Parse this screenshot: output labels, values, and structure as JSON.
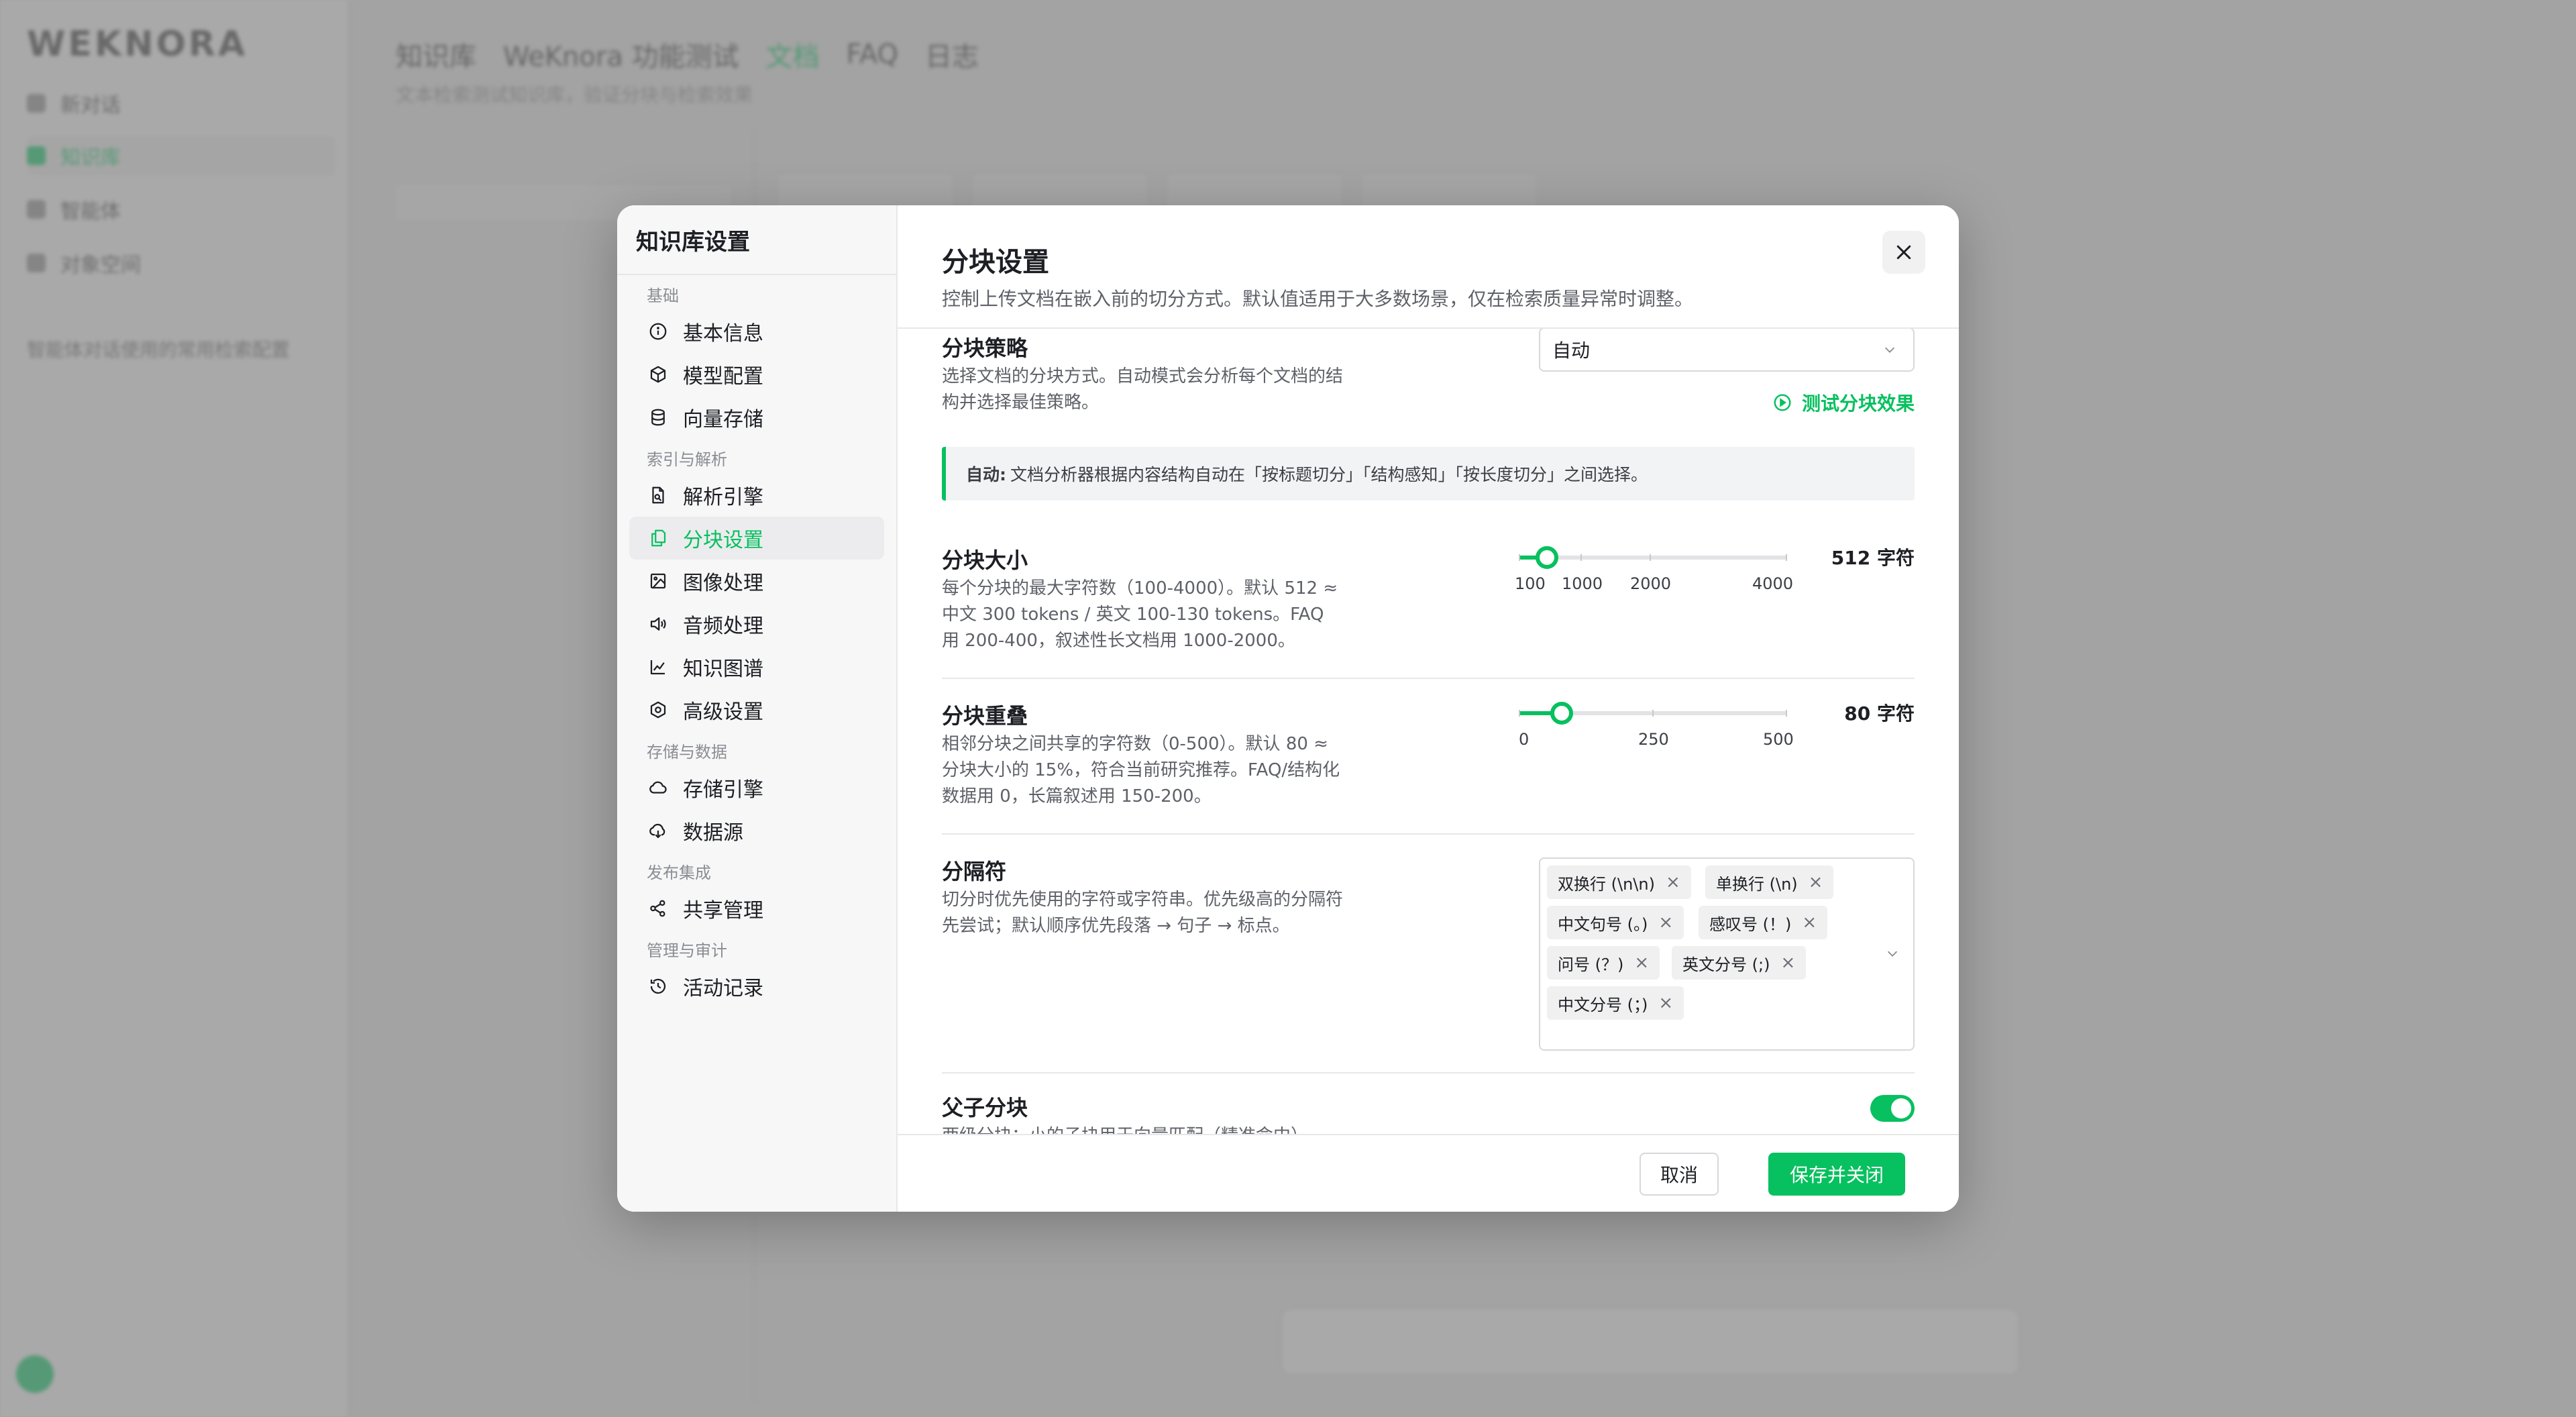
{
  "background": {
    "logo": "WEKNORA",
    "nav": [
      "新对话",
      "知识库",
      "智能体",
      "对象空间"
    ],
    "recent": "智能体对话使用的常用检索配置",
    "header": [
      "知识库",
      "WeKnora 功能测试",
      "文档",
      "FAQ",
      "日志"
    ],
    "subtitle": "文本检索测试知识库，验证分块与检索效果"
  },
  "modal": {
    "nav_title": "知识库设置",
    "groups": [
      {
        "label": "基础",
        "items": [
          {
            "label": "基本信息",
            "icon": "info-icon"
          },
          {
            "label": "模型配置",
            "icon": "cube-icon"
          },
          {
            "label": "向量存储",
            "icon": "database-icon"
          }
        ]
      },
      {
        "label": "索引与解析",
        "items": [
          {
            "label": "解析引擎",
            "icon": "file-search-icon"
          },
          {
            "label": "分块设置",
            "icon": "copy-icon",
            "active": true
          },
          {
            "label": "图像处理",
            "icon": "image-icon"
          },
          {
            "label": "音频处理",
            "icon": "speaker-icon"
          },
          {
            "label": "知识图谱",
            "icon": "graph-icon"
          },
          {
            "label": "高级设置",
            "icon": "hexagon-settings-icon"
          }
        ]
      },
      {
        "label": "存储与数据",
        "items": [
          {
            "label": "存储引擎",
            "icon": "cloud-icon"
          },
          {
            "label": "数据源",
            "icon": "cloud-download-icon"
          }
        ]
      },
      {
        "label": "发布集成",
        "items": [
          {
            "label": "共享管理",
            "icon": "share-icon"
          }
        ]
      },
      {
        "label": "管理与审计",
        "items": [
          {
            "label": "活动记录",
            "icon": "history-icon"
          }
        ]
      }
    ],
    "title": "分块设置",
    "description": "控制上传文档在嵌入前的切分方式。默认值适用于大多数场景，仅在检索质量异常时调整。",
    "strategy": {
      "title": "分块策略",
      "desc": "选择文档的分块方式。自动模式会分析每个文档的结构并选择最佳策略。",
      "value": "自动",
      "test_link": "测试分块效果",
      "note_bold": "自动:",
      "note_text": "文档分析器根据内容结构自动在「按标题切分」「结构感知」「按长度切分」之间选择。"
    },
    "chunk_size": {
      "title": "分块大小",
      "desc": "每个分块的最大字符数（100-4000）。默认 512 ≈ 中文 300 tokens / 英文 100-130 tokens。FAQ 用 200-400，叙述性长文档用 1000-2000。",
      "value": 512,
      "min": 100,
      "max": 4000,
      "value_label": "512 字符",
      "marks": [
        "100",
        "1000",
        "2000",
        "4000"
      ]
    },
    "chunk_overlap": {
      "title": "分块重叠",
      "desc": "相邻分块之间共享的字符数（0-500）。默认 80 ≈ 分块大小的 15%，符合当前研究推荐。FAQ/结构化数据用 0，长篇叙述用 150-200。",
      "value": 80,
      "min": 0,
      "max": 500,
      "value_label": "80 字符",
      "marks": [
        "0",
        "250",
        "500"
      ]
    },
    "separators": {
      "title": "分隔符",
      "desc": "切分时优先使用的字符或字符串。优先级高的分隔符先尝试；默认顺序优先段落 → 句子 → 标点。",
      "tags": [
        "双换行 (\\n\\n)",
        "单换行 (\\n)",
        "中文句号 (。)",
        "感叹号 (！)",
        "问号 (？)",
        "英文分号 (;)",
        "中文分号 (；)"
      ],
      "remove_glyph": "×"
    },
    "parent_child": {
      "title": "父子分块",
      "desc": "两级分块：小的子块用于向量匹配（精准命中）",
      "enabled": true
    },
    "cancel_label": "取消",
    "save_label": "保存并关闭"
  },
  "colors": {
    "accent": "#07c05f",
    "overlay": "rgba(60,60,60,0.35)"
  }
}
